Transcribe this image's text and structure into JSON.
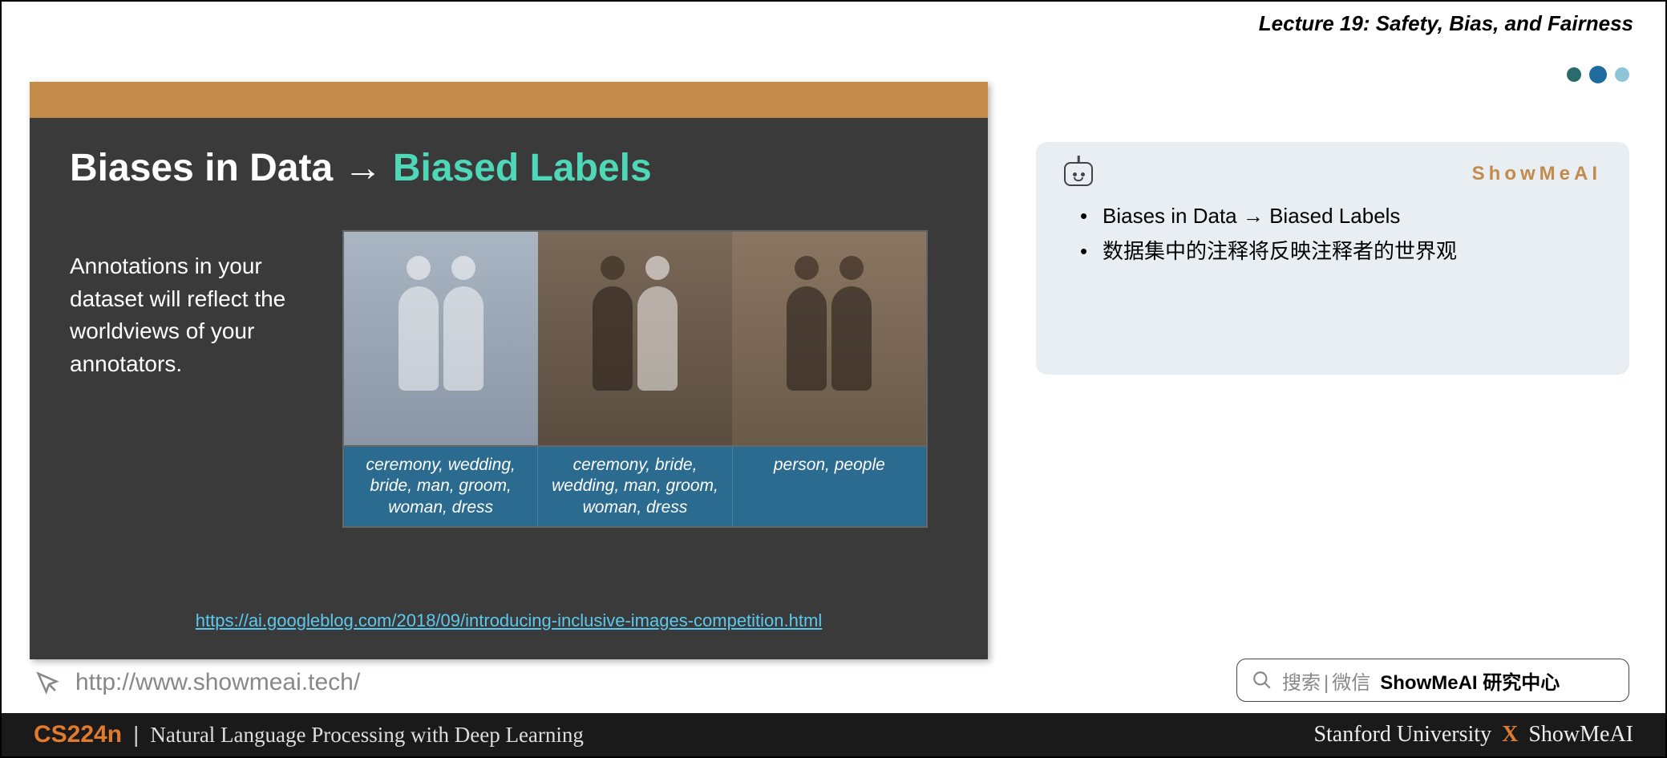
{
  "header": {
    "lecture": "Lecture 19: Safety, Bias, and Fairness"
  },
  "slide": {
    "title_white": "Biases in Data → ",
    "title_teal": "Biased Labels",
    "body_text": "Annotations in your dataset will reflect the worldviews of your annotators.",
    "labels": [
      "ceremony, wedding, bride, man, groom, woman, dress",
      "ceremony, bride, wedding, man, groom, woman, dress",
      "person, people"
    ],
    "link": "https://ai.googleblog.com/2018/09/introducing-inclusive-images-competition.html"
  },
  "notes": {
    "brand": "ShowMeAI",
    "items": [
      "Biases in Data → Biased Labels",
      "数据集中的注释将反映注释者的世界观"
    ]
  },
  "footer": {
    "url": "http://www.showmeai.tech/",
    "search_hint": "搜索",
    "search_sep": "|",
    "search_wechat": "微信",
    "search_bold": "ShowMeAI 研究中心"
  },
  "bottom": {
    "code": "CS224n",
    "sep": "|",
    "course": "Natural Language Processing with Deep Learning",
    "right_a": "Stanford University",
    "right_x": "X",
    "right_b": "ShowMeAI"
  }
}
